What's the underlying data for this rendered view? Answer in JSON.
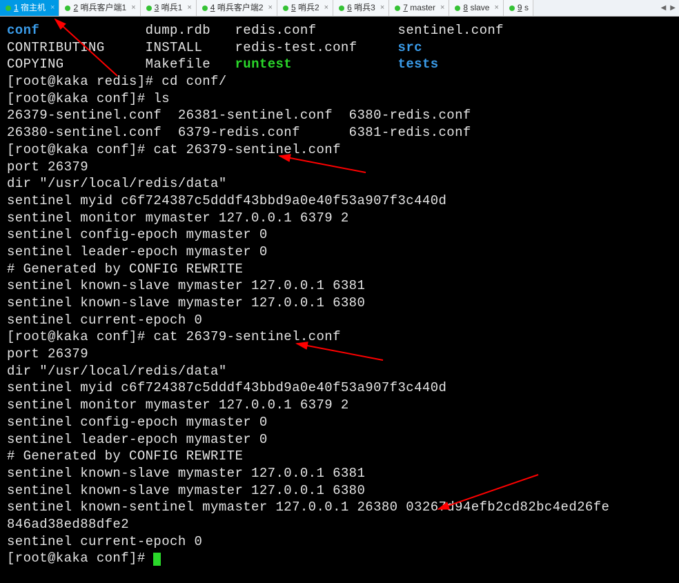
{
  "tabs": [
    {
      "num": "1",
      "label": "宿主机",
      "active": true
    },
    {
      "num": "2",
      "label": "哨兵客户端1",
      "active": false
    },
    {
      "num": "3",
      "label": "哨兵1",
      "active": false
    },
    {
      "num": "4",
      "label": "哨兵客户端2",
      "active": false
    },
    {
      "num": "5",
      "label": "哨兵2",
      "active": false
    },
    {
      "num": "6",
      "label": "哨兵3",
      "active": false
    },
    {
      "num": "7",
      "label": "master",
      "active": false
    },
    {
      "num": "8",
      "label": "slave",
      "active": false
    },
    {
      "num": "9",
      "label": "s",
      "active": false
    }
  ],
  "ls_row1": {
    "c1": "conf",
    "c2": "dump.rdb",
    "c3": "redis.conf",
    "c4": "sentinel.conf"
  },
  "ls_row2": {
    "c1": "CONTRIBUTING",
    "c2": "INSTALL",
    "c3": "redis-test.conf",
    "c4": "src"
  },
  "ls_row3": {
    "c1": "COPYING",
    "c2": "Makefile",
    "c3": "runtest",
    "c4": "tests"
  },
  "prompt1": "[root@kaka redis]# ",
  "cmd1": "cd conf/",
  "prompt2": "[root@kaka conf]# ",
  "cmd2": "ls",
  "ls2": "26379-sentinel.conf  26381-sentinel.conf  6380-redis.conf",
  "ls2b": "26380-sentinel.conf  6379-redis.conf      6381-redis.conf",
  "prompt3": "[root@kaka conf]# ",
  "cmd3": "cat 26379-sentinel.conf",
  "conf_lines": [
    "port 26379",
    "dir \"/usr/local/redis/data\"",
    "sentinel myid c6f724387c5dddf43bbd9a0e40f53a907f3c440d",
    "sentinel monitor mymaster 127.0.0.1 6379 2",
    "sentinel config-epoch mymaster 0",
    "sentinel leader-epoch mymaster 0",
    "# Generated by CONFIG REWRITE",
    "sentinel known-slave mymaster 127.0.0.1 6381",
    "sentinel known-slave mymaster 127.0.0.1 6380",
    "sentinel current-epoch 0"
  ],
  "prompt4": "[root@kaka conf]# ",
  "cmd4": "cat 26379-sentinel.conf",
  "conf2_lines": [
    "port 26379",
    "dir \"/usr/local/redis/data\"",
    "sentinel myid c6f724387c5dddf43bbd9a0e40f53a907f3c440d",
    "sentinel monitor mymaster 127.0.0.1 6379 2",
    "sentinel config-epoch mymaster 0",
    "sentinel leader-epoch mymaster 0",
    "# Generated by CONFIG REWRITE",
    "sentinel known-slave mymaster 127.0.0.1 6381",
    "sentinel known-slave mymaster 127.0.0.1 6380",
    "sentinel known-sentinel mymaster 127.0.0.1 26380 03267d94efb2cd82bc4ed26fe",
    "846ad38ed88dfe2",
    "sentinel current-epoch 0"
  ],
  "prompt5": "[root@kaka conf]# "
}
